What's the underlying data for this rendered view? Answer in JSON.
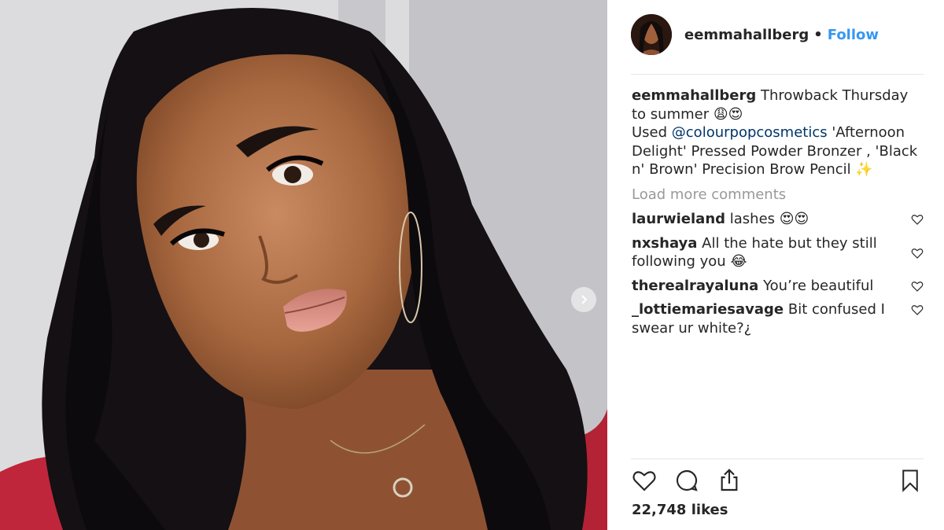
{
  "post": {
    "username": "eemmahallberg",
    "separator": "•",
    "follow_label": "Follow",
    "caption": {
      "user": "eemmahallberg",
      "text_1": "Throwback Thursday to summer 😩😍",
      "text_2": "Used ",
      "mention": "@colourpopcosmetics",
      "text_3": " 'Afternoon Delight' Pressed Powder Bronzer , 'Black n' Brown' Precision Brow Pencil ✨"
    },
    "load_more": "Load more comments",
    "comments": [
      {
        "user": "laurwieland",
        "text": "lashes 😍😍"
      },
      {
        "user": "nxshaya",
        "text": "All the hate but they still following you 😂"
      },
      {
        "user": "therealrayaluna",
        "text": "You’re beautiful"
      },
      {
        "user": "_lottiemariesavage",
        "text": "Bit confused I swear ur white?¿"
      }
    ],
    "likes": "22,748 likes"
  },
  "icons": {
    "like": "heart-icon",
    "comment": "comment-bubble-icon",
    "share": "share-icon",
    "save": "bookmark-icon",
    "next": "chevron-right-icon"
  },
  "colors": {
    "link": "#3897f0",
    "mention": "#003569",
    "muted": "#999999",
    "text": "#262626"
  }
}
